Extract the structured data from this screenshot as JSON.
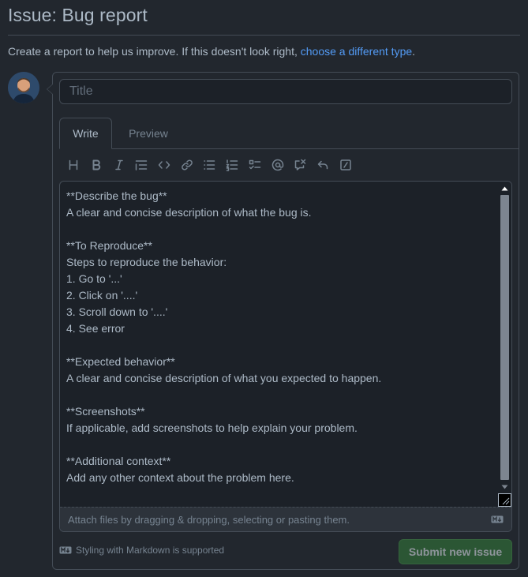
{
  "page": {
    "title": "Issue: Bug report",
    "intro_text": "Create a report to help us improve. If this doesn't look right, ",
    "intro_link": "choose a different type",
    "intro_suffix": "."
  },
  "form": {
    "title_placeholder": "Title",
    "tabs": {
      "write": "Write",
      "preview": "Preview"
    },
    "toolbar_icons": [
      "heading-icon",
      "bold-icon",
      "italic-icon",
      "quote-icon",
      "code-icon",
      "link-icon",
      "bulleted-list-icon",
      "numbered-list-icon",
      "task-list-icon",
      "mention-icon",
      "cross-reference-icon",
      "saved-reply-icon",
      "slash-command-icon"
    ],
    "body": "**Describe the bug**\nA clear and concise description of what the bug is.\n\n**To Reproduce**\nSteps to reproduce the behavior:\n1. Go to '...'\n2. Click on '....'\n3. Scroll down to '....'\n4. See error\n\n**Expected behavior**\nA clear and concise description of what you expected to happen.\n\n**Screenshots**\nIf applicable, add screenshots to help explain your problem.\n\n**Additional context**\nAdd any other context about the problem here.",
    "attach_text": "Attach files by dragging & dropping, selecting or pasting them.",
    "markdown_note": "Styling with Markdown is supported",
    "submit_label": "Submit new issue"
  },
  "colors": {
    "background": "#22272e",
    "link": "#539bf5",
    "submit": "#347d39"
  }
}
